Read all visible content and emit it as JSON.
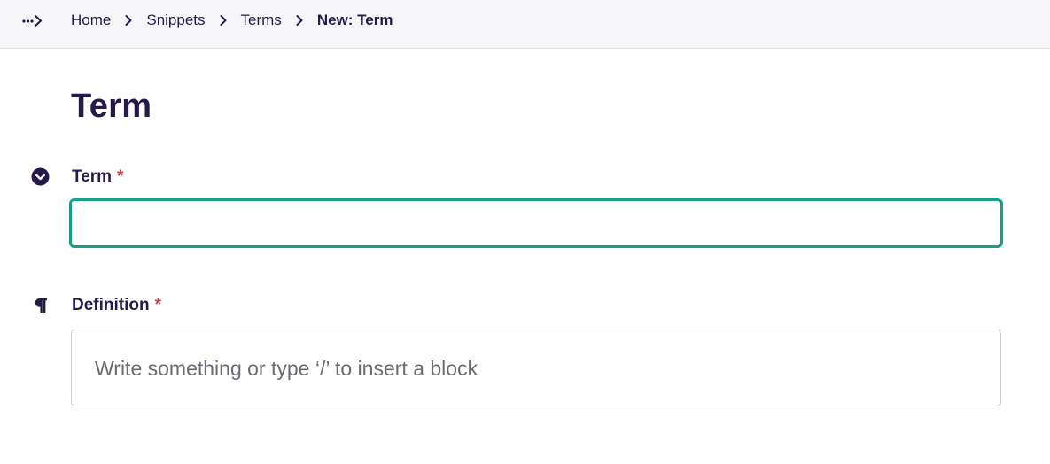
{
  "breadcrumb": {
    "toggle_icon": "ellipsis-chevron-right-icon",
    "items": [
      {
        "label": "Home"
      },
      {
        "label": "Snippets"
      },
      {
        "label": "Terms"
      },
      {
        "label": "New: Term"
      }
    ]
  },
  "page": {
    "title": "Term"
  },
  "fields": {
    "term": {
      "label": "Term",
      "required_mark": "*",
      "icon": "chevron-down-circle-icon",
      "value": ""
    },
    "definition": {
      "label": "Definition",
      "required_mark": "*",
      "icon": "pilcrow-icon",
      "placeholder": "Write something or type ‘/’ to insert a block"
    }
  },
  "colors": {
    "primary_text": "#261a4b",
    "focus_border": "#1b9e87",
    "required": "#cd4444",
    "header_bg": "#f6f6f8"
  }
}
